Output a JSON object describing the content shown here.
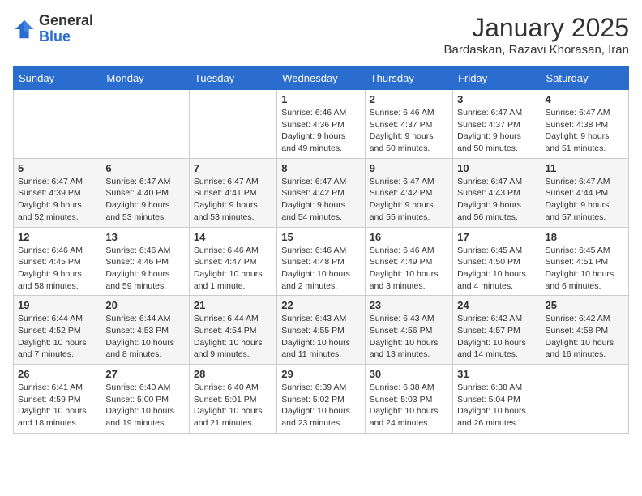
{
  "logo": {
    "general": "General",
    "blue": "Blue"
  },
  "header": {
    "title": "January 2025",
    "subtitle": "Bardaskan, Razavi Khorasan, Iran"
  },
  "weekdays": [
    "Sunday",
    "Monday",
    "Tuesday",
    "Wednesday",
    "Thursday",
    "Friday",
    "Saturday"
  ],
  "weeks": [
    [
      {
        "day": "",
        "info": ""
      },
      {
        "day": "",
        "info": ""
      },
      {
        "day": "",
        "info": ""
      },
      {
        "day": "1",
        "info": "Sunrise: 6:46 AM\nSunset: 4:36 PM\nDaylight: 9 hours and 49 minutes."
      },
      {
        "day": "2",
        "info": "Sunrise: 6:46 AM\nSunset: 4:37 PM\nDaylight: 9 hours and 50 minutes."
      },
      {
        "day": "3",
        "info": "Sunrise: 6:47 AM\nSunset: 4:37 PM\nDaylight: 9 hours and 50 minutes."
      },
      {
        "day": "4",
        "info": "Sunrise: 6:47 AM\nSunset: 4:38 PM\nDaylight: 9 hours and 51 minutes."
      }
    ],
    [
      {
        "day": "5",
        "info": "Sunrise: 6:47 AM\nSunset: 4:39 PM\nDaylight: 9 hours and 52 minutes."
      },
      {
        "day": "6",
        "info": "Sunrise: 6:47 AM\nSunset: 4:40 PM\nDaylight: 9 hours and 53 minutes."
      },
      {
        "day": "7",
        "info": "Sunrise: 6:47 AM\nSunset: 4:41 PM\nDaylight: 9 hours and 53 minutes."
      },
      {
        "day": "8",
        "info": "Sunrise: 6:47 AM\nSunset: 4:42 PM\nDaylight: 9 hours and 54 minutes."
      },
      {
        "day": "9",
        "info": "Sunrise: 6:47 AM\nSunset: 4:42 PM\nDaylight: 9 hours and 55 minutes."
      },
      {
        "day": "10",
        "info": "Sunrise: 6:47 AM\nSunset: 4:43 PM\nDaylight: 9 hours and 56 minutes."
      },
      {
        "day": "11",
        "info": "Sunrise: 6:47 AM\nSunset: 4:44 PM\nDaylight: 9 hours and 57 minutes."
      }
    ],
    [
      {
        "day": "12",
        "info": "Sunrise: 6:46 AM\nSunset: 4:45 PM\nDaylight: 9 hours and 58 minutes."
      },
      {
        "day": "13",
        "info": "Sunrise: 6:46 AM\nSunset: 4:46 PM\nDaylight: 9 hours and 59 minutes."
      },
      {
        "day": "14",
        "info": "Sunrise: 6:46 AM\nSunset: 4:47 PM\nDaylight: 10 hours and 1 minute."
      },
      {
        "day": "15",
        "info": "Sunrise: 6:46 AM\nSunset: 4:48 PM\nDaylight: 10 hours and 2 minutes."
      },
      {
        "day": "16",
        "info": "Sunrise: 6:46 AM\nSunset: 4:49 PM\nDaylight: 10 hours and 3 minutes."
      },
      {
        "day": "17",
        "info": "Sunrise: 6:45 AM\nSunset: 4:50 PM\nDaylight: 10 hours and 4 minutes."
      },
      {
        "day": "18",
        "info": "Sunrise: 6:45 AM\nSunset: 4:51 PM\nDaylight: 10 hours and 6 minutes."
      }
    ],
    [
      {
        "day": "19",
        "info": "Sunrise: 6:44 AM\nSunset: 4:52 PM\nDaylight: 10 hours and 7 minutes."
      },
      {
        "day": "20",
        "info": "Sunrise: 6:44 AM\nSunset: 4:53 PM\nDaylight: 10 hours and 8 minutes."
      },
      {
        "day": "21",
        "info": "Sunrise: 6:44 AM\nSunset: 4:54 PM\nDaylight: 10 hours and 9 minutes."
      },
      {
        "day": "22",
        "info": "Sunrise: 6:43 AM\nSunset: 4:55 PM\nDaylight: 10 hours and 11 minutes."
      },
      {
        "day": "23",
        "info": "Sunrise: 6:43 AM\nSunset: 4:56 PM\nDaylight: 10 hours and 13 minutes."
      },
      {
        "day": "24",
        "info": "Sunrise: 6:42 AM\nSunset: 4:57 PM\nDaylight: 10 hours and 14 minutes."
      },
      {
        "day": "25",
        "info": "Sunrise: 6:42 AM\nSunset: 4:58 PM\nDaylight: 10 hours and 16 minutes."
      }
    ],
    [
      {
        "day": "26",
        "info": "Sunrise: 6:41 AM\nSunset: 4:59 PM\nDaylight: 10 hours and 18 minutes."
      },
      {
        "day": "27",
        "info": "Sunrise: 6:40 AM\nSunset: 5:00 PM\nDaylight: 10 hours and 19 minutes."
      },
      {
        "day": "28",
        "info": "Sunrise: 6:40 AM\nSunset: 5:01 PM\nDaylight: 10 hours and 21 minutes."
      },
      {
        "day": "29",
        "info": "Sunrise: 6:39 AM\nSunset: 5:02 PM\nDaylight: 10 hours and 23 minutes."
      },
      {
        "day": "30",
        "info": "Sunrise: 6:38 AM\nSunset: 5:03 PM\nDaylight: 10 hours and 24 minutes."
      },
      {
        "day": "31",
        "info": "Sunrise: 6:38 AM\nSunset: 5:04 PM\nDaylight: 10 hours and 26 minutes."
      },
      {
        "day": "",
        "info": ""
      }
    ]
  ]
}
